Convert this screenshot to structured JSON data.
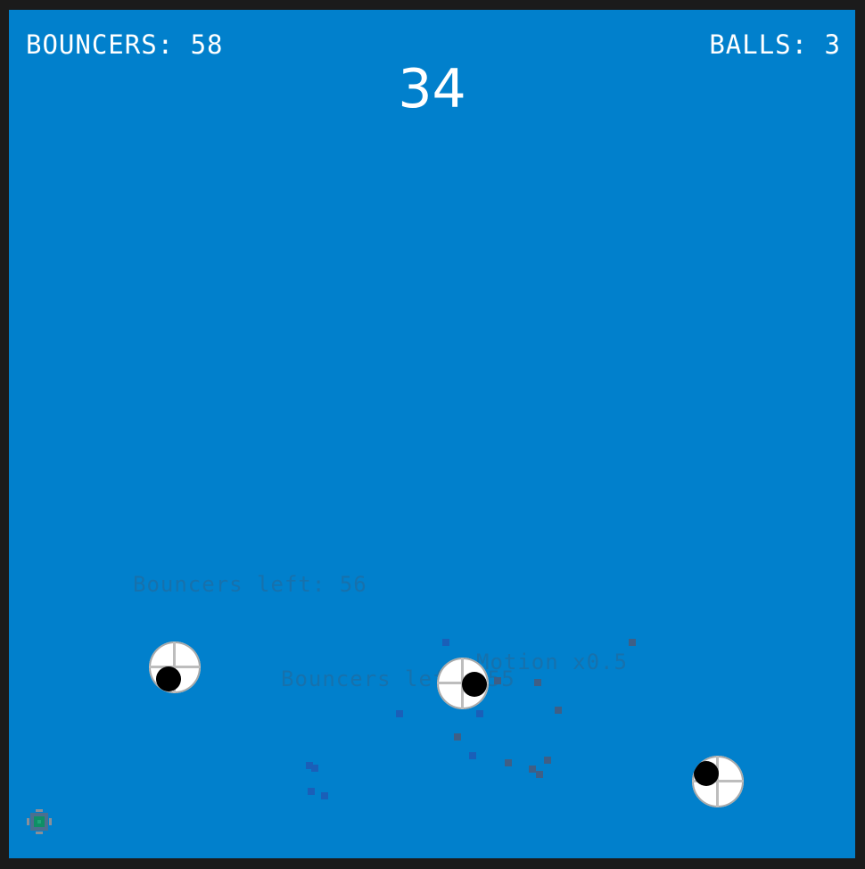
{
  "hud": {
    "bouncers_label": "BOUNCERS: 58",
    "balls_label": "BALLS: 3",
    "timer": "34"
  },
  "floating_texts": [
    "Bouncers left: 56",
    "Bouncers left: 55",
    "Motion x0.5"
  ],
  "colors": {
    "field": "#0180cc",
    "frame": "#1b1b1b",
    "hud_text": "#ffffff",
    "ghost_text": "#1c6fa7",
    "particle_blue": "#1a5fb8",
    "particle_gray": "#3f5f86"
  },
  "icons": {
    "ball": "soccer-ball-icon",
    "player": "crosshair-icon"
  }
}
